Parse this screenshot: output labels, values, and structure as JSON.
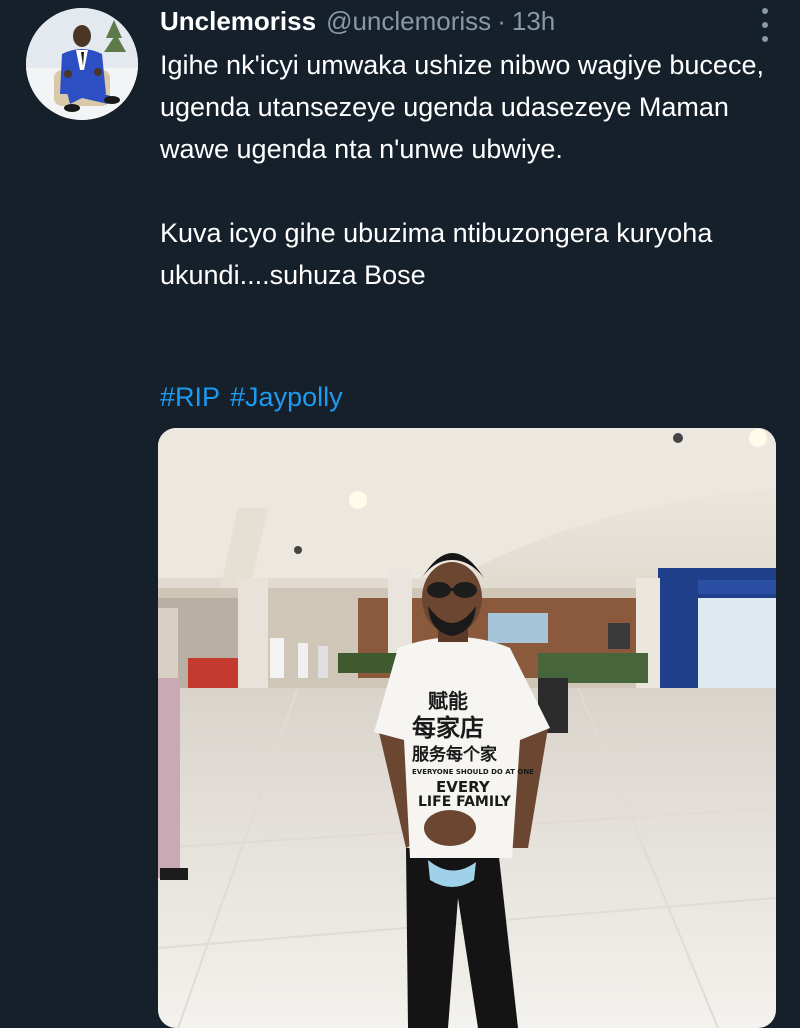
{
  "tweet": {
    "display_name": "Unclemoriss",
    "handle": "@unclemoriss",
    "separator": "·",
    "time": "13h",
    "text": "Igihe nk'icyi umwaka ushize nibwo wagiye bucece, ugenda utansezeye ugenda udasezeye Maman wawe ugenda nta n'unwe ubwiye.\n\nKuva icyo gihe ubuzima ntibuzongera kuryoha ukundi....suhuza Bose",
    "hashtags": [
      "#RIP",
      "#Jaypolly"
    ]
  },
  "media": {
    "shirt_text": [
      "赋能",
      "每家店",
      "服务每个家",
      "EVERYONE SHOULD DO AT ONE",
      "EVERY",
      "LIFE FAMILY"
    ]
  },
  "colors": {
    "background": "#15202b",
    "text": "#ffffff",
    "muted": "#8899a6",
    "link": "#1d9bf0"
  },
  "icons": {
    "more": "more-vertical-icon"
  }
}
